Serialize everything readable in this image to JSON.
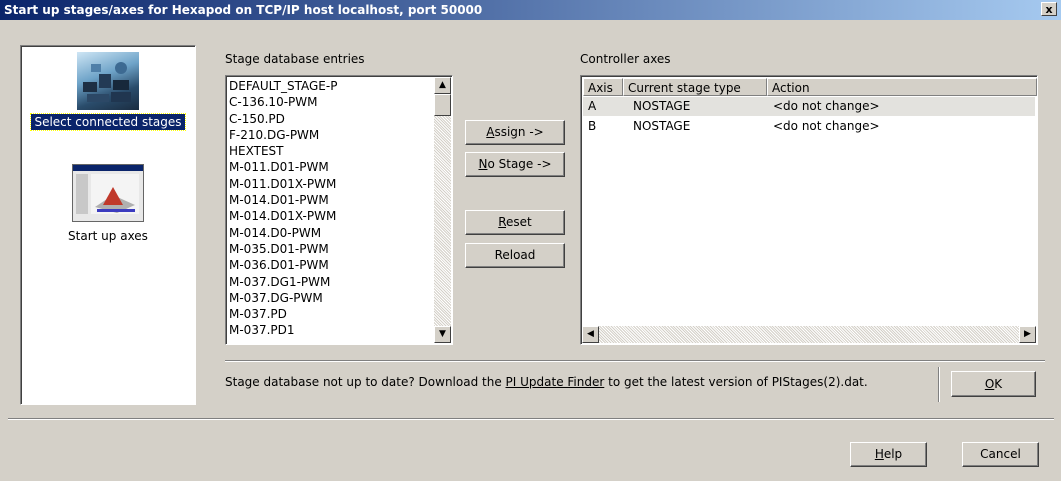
{
  "window": {
    "title": "Start up stages/axes for Hexapod on TCP/IP host localhost, port 50000",
    "close_label": "x"
  },
  "nav": {
    "items": [
      {
        "label": "Select connected stages",
        "selected": true,
        "icon": "hexapod-stages-icon"
      },
      {
        "label": "Start up axes",
        "selected": false,
        "icon": "axes-graph-icon"
      }
    ]
  },
  "stage_db": {
    "heading": "Stage database entries",
    "entries": [
      "DEFAULT_STAGE-P",
      "C-136.10-PWM",
      "C-150.PD",
      "F-210.DG-PWM",
      "HEXTEST",
      "M-011.D01-PWM",
      "M-011.D01X-PWM",
      "M-014.D01-PWM",
      "M-014.D01X-PWM",
      "M-014.D0-PWM",
      "M-035.D01-PWM",
      "M-036.D01-PWM",
      "M-037.DG1-PWM",
      "M-037.DG-PWM",
      "M-037.PD",
      "M-037.PD1"
    ]
  },
  "actions": {
    "assign": {
      "mnemonic": "A",
      "rest": "ssign ->"
    },
    "no_stage": {
      "mnemonic": "N",
      "rest": "o Stage ->"
    },
    "reset": {
      "mnemonic": "R",
      "rest": "eset"
    },
    "reload": "Reload"
  },
  "controller": {
    "heading": "Controller axes",
    "columns": [
      "Axis",
      "Current stage type",
      "Action"
    ],
    "rows": [
      {
        "axis": "A",
        "stage": "NOSTAGE",
        "action": "<do not change>",
        "selected": true
      },
      {
        "axis": "B",
        "stage": "NOSTAGE",
        "action": "<do not change>",
        "selected": false
      }
    ]
  },
  "notice": {
    "before": "Stage database not up to date? Download the ",
    "link": "PI Update Finder",
    "after": " to get the latest version of PIStages(2).dat."
  },
  "buttons": {
    "ok": {
      "mnemonic": "O",
      "rest": "K"
    },
    "help": {
      "mnemonic": "H",
      "rest": "elp"
    },
    "cancel": "Cancel"
  },
  "colors": {
    "title_bar_start": "#0a246a",
    "title_bar_end": "#a6caf0",
    "dialog_bg": "#d4d0c8",
    "selection": "#0a246a"
  }
}
